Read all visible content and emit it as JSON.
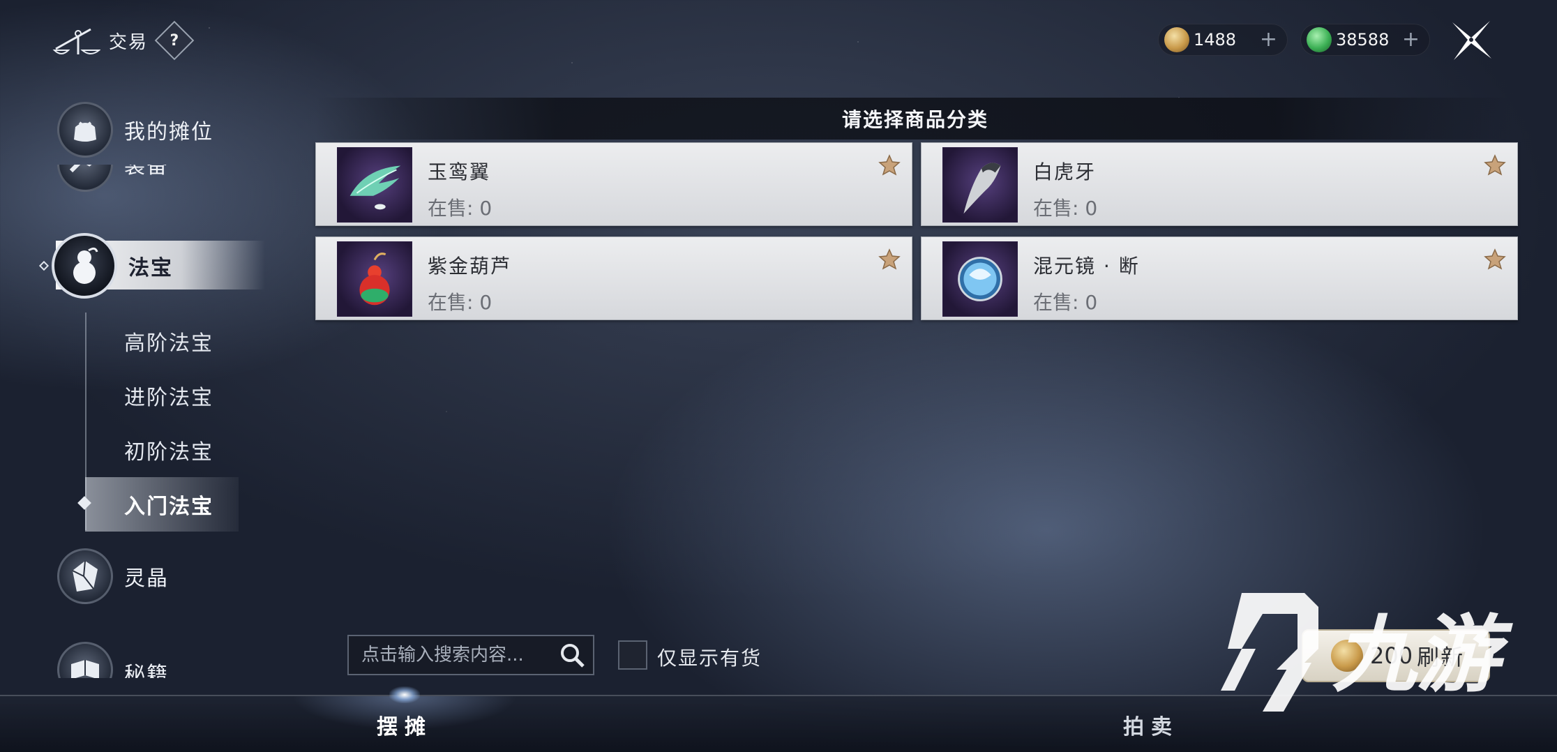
{
  "header": {
    "title": "交易",
    "help_label": "?",
    "currencies": [
      {
        "icon": "gold-coin-icon",
        "amount": "1488",
        "plus": "+"
      },
      {
        "icon": "jade-coin-icon",
        "amount": "38588",
        "plus": "+"
      }
    ]
  },
  "sidebar": {
    "main_items": [
      {
        "label": "我的摊位",
        "icon": "stall-bag-icon"
      },
      {
        "label": "装备",
        "icon": "equipment-icon"
      },
      {
        "label": "法宝",
        "icon": "gourd-icon",
        "active": true
      },
      {
        "label": "灵晶",
        "icon": "crystal-icon"
      },
      {
        "label": "秘籍",
        "icon": "book-icon"
      }
    ],
    "sub_items": [
      {
        "label": "高阶法宝"
      },
      {
        "label": "进阶法宝"
      },
      {
        "label": "初阶法宝"
      },
      {
        "label": "入门法宝",
        "active": true
      }
    ]
  },
  "main": {
    "section_title": "请选择商品分类",
    "items": [
      {
        "name": "玉鸾翼",
        "stock": "在售: 0",
        "icon": "jade-wing-icon"
      },
      {
        "name": "白虎牙",
        "stock": "在售: 0",
        "icon": "tiger-fang-icon"
      },
      {
        "name": "紫金葫芦",
        "stock": "在售: 0",
        "icon": "purple-gold-gourd-icon"
      },
      {
        "name": "混元镜 · 断",
        "stock": "在售: 0",
        "icon": "hunyuan-mirror-icon"
      }
    ]
  },
  "controls": {
    "search_placeholder": "点击输入搜索内容...",
    "only_in_stock_label": "仅显示有货",
    "refresh_cost": "200",
    "refresh_label": "刷新"
  },
  "tabs": [
    {
      "label": "摆摊",
      "active": true
    },
    {
      "label": "拍卖",
      "active": false
    }
  ],
  "watermark": {
    "text": "九游"
  },
  "colors": {
    "card_bg": "#e3e4e7",
    "item_thumb_bg": "#3a2a5c",
    "gold": "#c99a4a",
    "jade": "#3cb055"
  }
}
